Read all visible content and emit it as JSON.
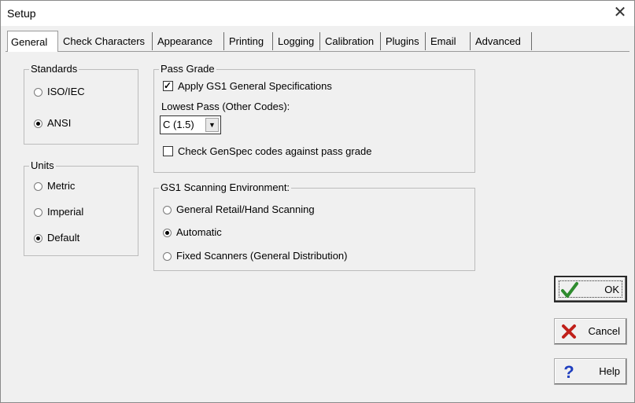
{
  "window": {
    "title": "Setup",
    "close_glyph": "✕"
  },
  "tabs": [
    {
      "label": "General",
      "active": true
    },
    {
      "label": "Check Characters"
    },
    {
      "label": "Appearance"
    },
    {
      "label": "Printing"
    },
    {
      "label": "Logging"
    },
    {
      "label": "Calibration"
    },
    {
      "label": "Plugins"
    },
    {
      "label": "Email"
    },
    {
      "label": "Advanced"
    }
  ],
  "standards": {
    "legend": "Standards",
    "options": [
      {
        "label": "ISO/IEC",
        "checked": false
      },
      {
        "label": "ANSI",
        "checked": true
      }
    ]
  },
  "units": {
    "legend": "Units",
    "options": [
      {
        "label": "Metric",
        "checked": false
      },
      {
        "label": "Imperial",
        "checked": false
      },
      {
        "label": "Default",
        "checked": true
      }
    ]
  },
  "pass_grade": {
    "legend": "Pass Grade",
    "apply_gs1_label": "Apply GS1 General Specifications",
    "apply_gs1_checked": true,
    "lowest_pass_label": "Lowest Pass (Other Codes):",
    "lowest_pass_value": "C (1.5)",
    "check_genspec_label": "Check GenSpec codes against pass grade",
    "check_genspec_checked": false
  },
  "scanning": {
    "legend": "GS1 Scanning Environment:",
    "options": [
      {
        "label": "General Retail/Hand Scanning",
        "checked": false
      },
      {
        "label": "Automatic",
        "checked": true
      },
      {
        "label": "Fixed Scanners (General Distribution)",
        "checked": false
      }
    ]
  },
  "buttons": {
    "ok_label": "OK",
    "cancel_label": "Cancel",
    "help_label": "Help"
  },
  "colors": {
    "ok_check": "#2e8b2e",
    "cancel_x": "#c0201a",
    "help_q": "#1f3fbf"
  }
}
